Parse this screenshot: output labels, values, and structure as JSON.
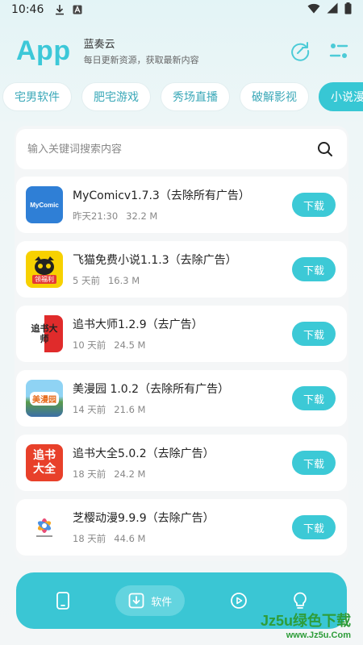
{
  "status_bar": {
    "time": "10:46"
  },
  "header": {
    "title": "App",
    "name": "蓝奏云",
    "subtitle": "每日更新资源，获取最新内容"
  },
  "categories": [
    "宅男软件",
    "肥宅游戏",
    "秀场直播",
    "破解影视",
    "小说漫画"
  ],
  "active_category": 4,
  "search": {
    "placeholder": "输入关键词搜索内容"
  },
  "items": [
    {
      "name": "MyComicv1.7.3（去除所有广告）",
      "time": "昨天21:30",
      "size": "32.2 M",
      "button": "下载",
      "icon_text": "MyComic"
    },
    {
      "name": "飞猫免费小说1.1.3（去除广告）",
      "time": "5 天前",
      "size": "16.3 M",
      "button": "下载",
      "icon_text": "领福利"
    },
    {
      "name": "追书大师1.2.9（去广告）",
      "time": "10 天前",
      "size": "24.5 M",
      "button": "下载",
      "icon_text": "追书大师"
    },
    {
      "name": "美漫园 1.0.2（去除所有广告）",
      "time": "14 天前",
      "size": "21.6 M",
      "button": "下载",
      "icon_text": "美漫园"
    },
    {
      "name": "追书大全5.0.2（去除广告）",
      "time": "18 天前",
      "size": "24.2 M",
      "button": "下载",
      "icon_text": "追书大全"
    },
    {
      "name": "芝樱动漫9.9.9（去除广告）",
      "time": "18 天前",
      "size": "44.6 M",
      "button": "下载",
      "icon_text": ""
    }
  ],
  "bottom_nav": {
    "active_label": "软件"
  },
  "watermark": "Jz5u绿色下载\nwww.Jz5u.Com",
  "colors": {
    "accent": "#3cc9d6",
    "title": "#3cc8d8"
  }
}
